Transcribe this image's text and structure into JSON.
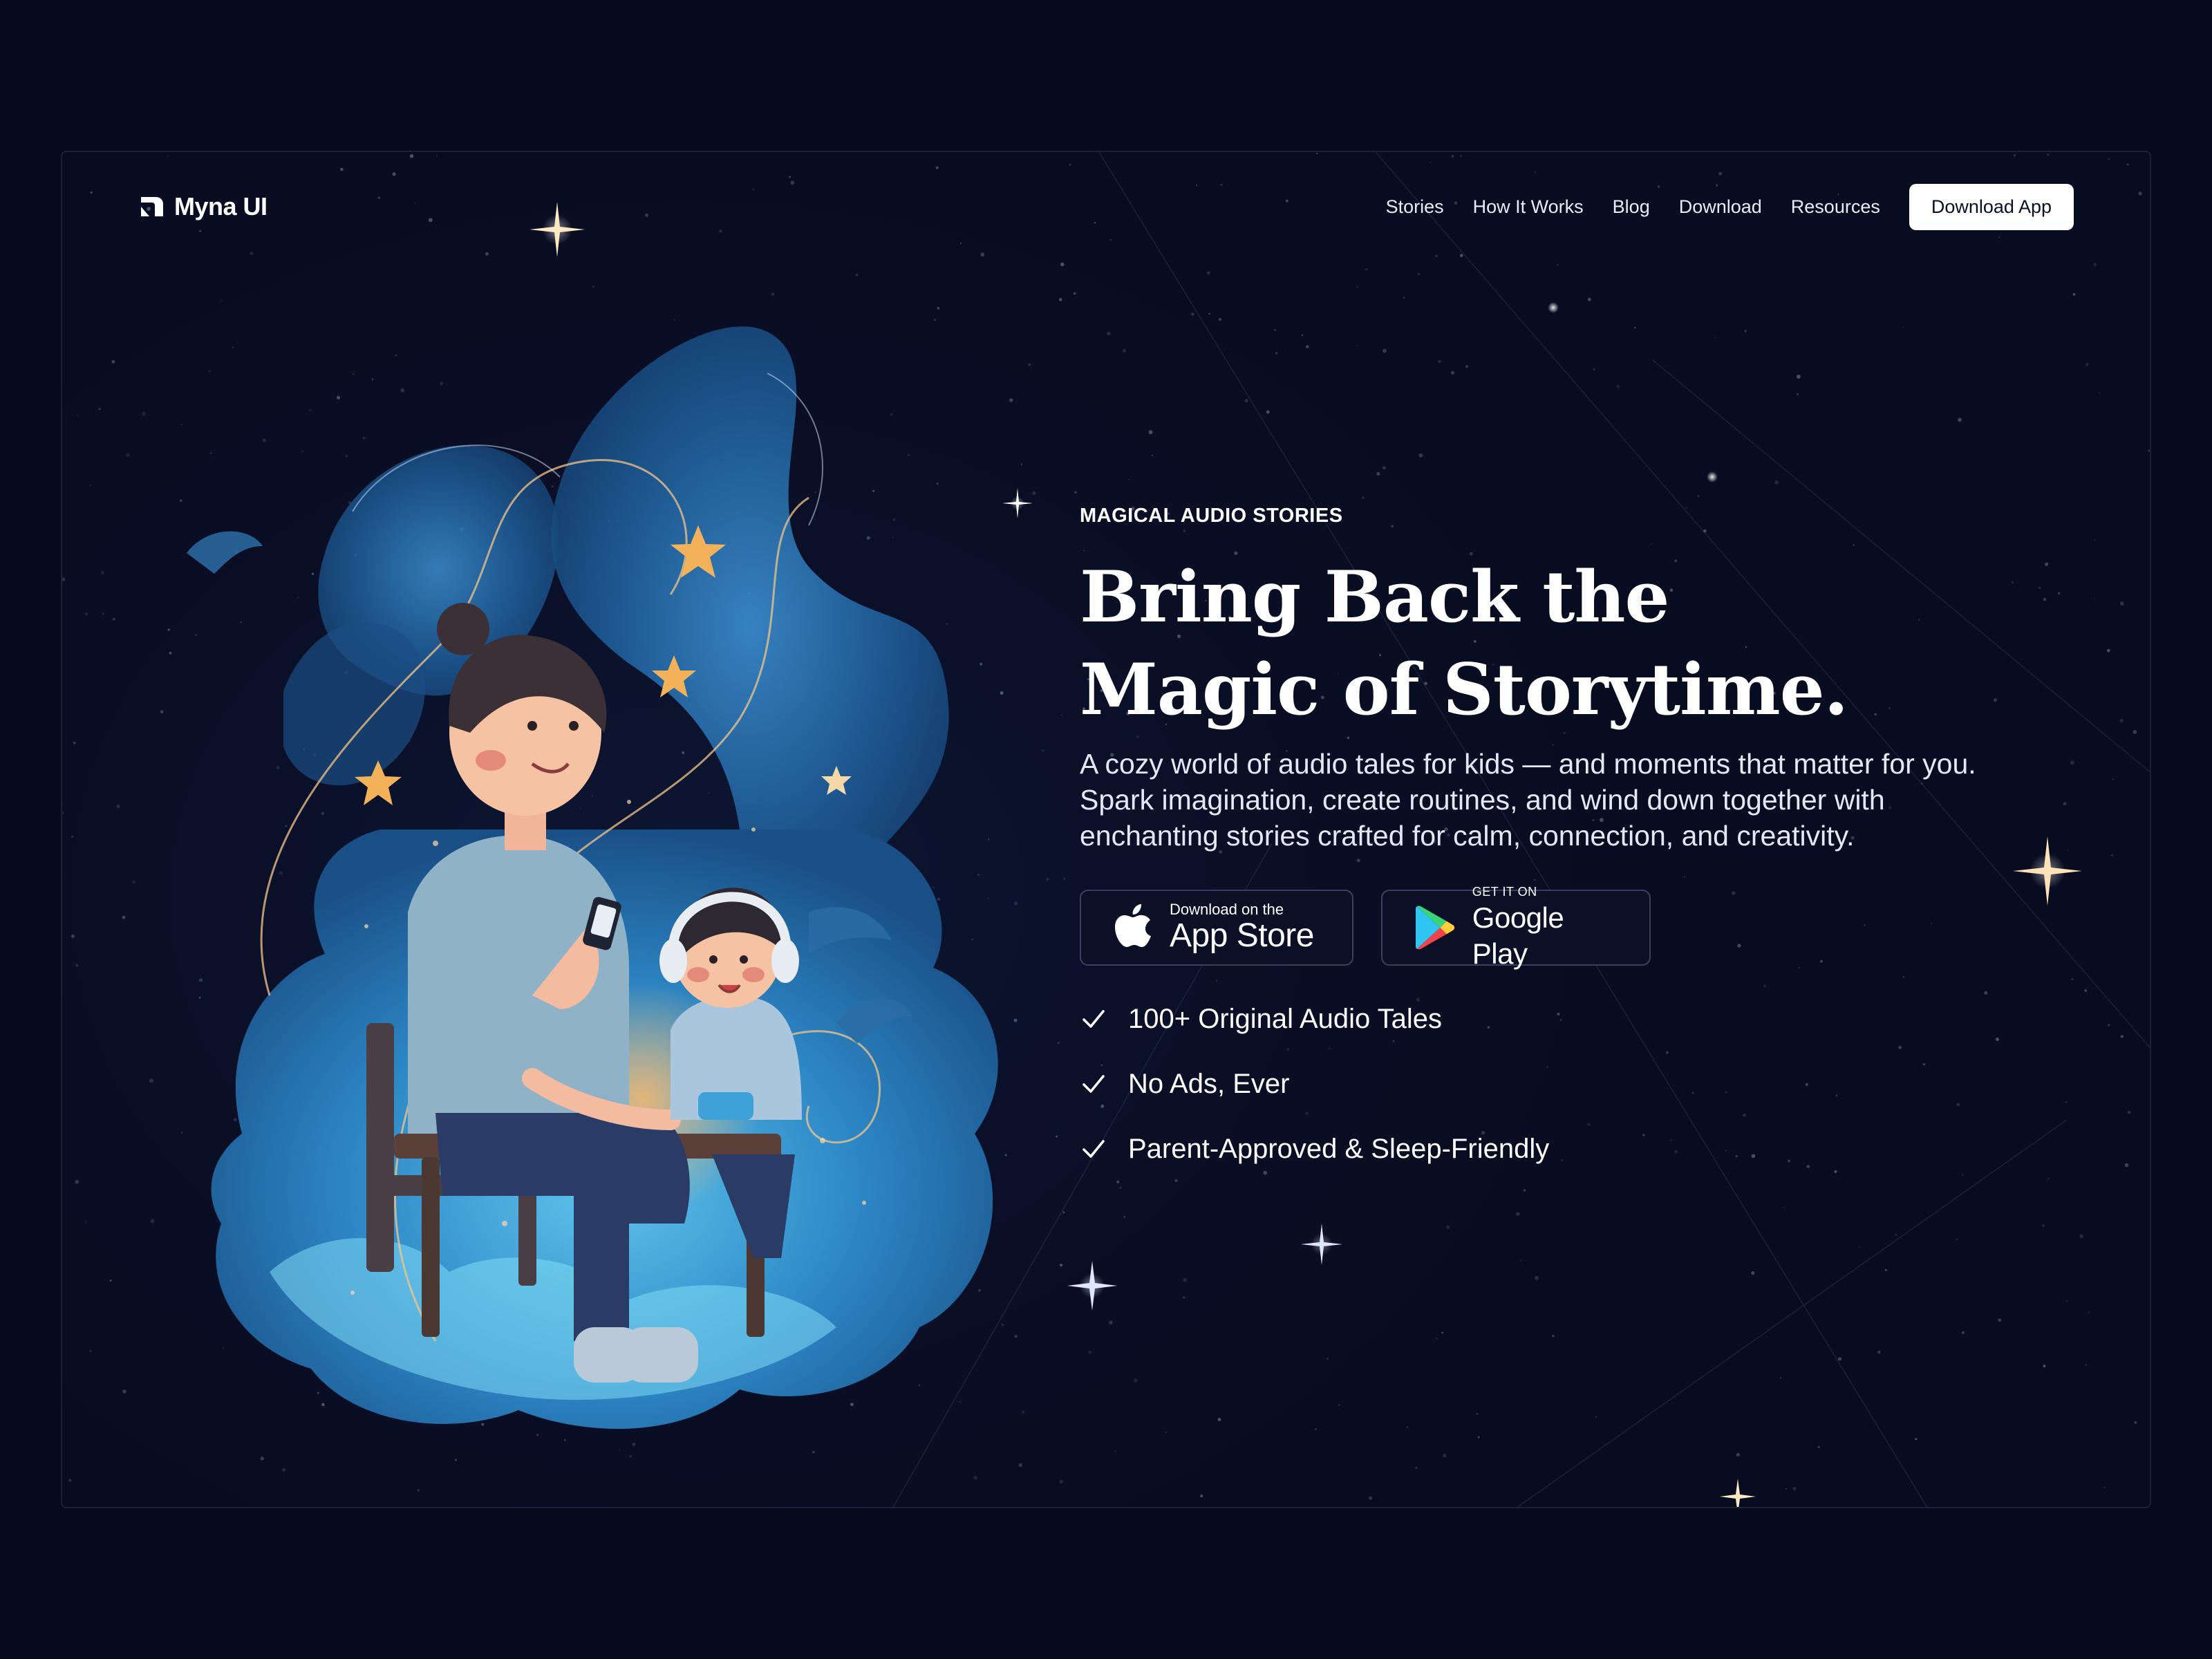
{
  "brand": {
    "name": "Myna UI"
  },
  "nav": {
    "links": [
      "Stories",
      "How It Works",
      "Blog",
      "Download",
      "Resources"
    ],
    "cta_label": "Download App"
  },
  "hero": {
    "eyebrow": "MAGICAL AUDIO STORIES",
    "title_line1": "Bring Back the",
    "title_line2": "Magic of Storytime.",
    "description": "A cozy world of audio tales for kids — and moments that matter for you. Spark imagination, create routines, and wind down together with enchanting stories crafted for calm, connection, and creativity."
  },
  "stores": {
    "apple": {
      "small": "Download on the",
      "big": "App Store"
    },
    "google": {
      "small": "GET IT ON",
      "big": "Google Play"
    }
  },
  "features": [
    "100+ Original Audio Tales",
    "No Ads, Ever",
    "Parent-Approved & Sleep-Friendly"
  ],
  "colors": {
    "background": "#070a1c",
    "panel": "#0a1028",
    "accent_star": "#f3b25a",
    "cloud_blue": "#2f7fc2"
  },
  "icons": [
    "myna-logo-icon",
    "apple-icon",
    "google-play-icon",
    "check-icon"
  ]
}
